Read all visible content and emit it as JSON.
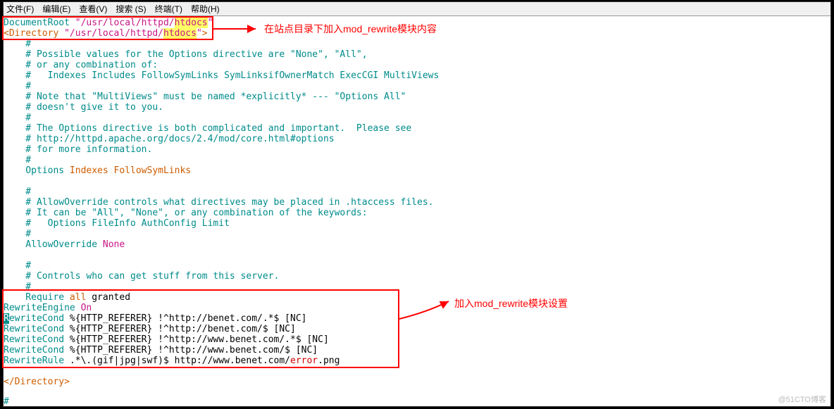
{
  "menu": {
    "file": "文件(F)",
    "edit": "编辑(E)",
    "view": "查看(V)",
    "search": "搜索 (S)",
    "terminal": "终端(T)",
    "help": "帮助(H)"
  },
  "doc": {
    "docroot_key": "DocumentRoot",
    "dir_key": "<Directory",
    "dir_close": ">",
    "path_prefix": " \"/usr/local/httpd/",
    "path_hl": "htdocs",
    "path_suffix": "\"",
    "c_indent": "    # ",
    "c_hashonly": "    #",
    "c_possible": "Possible values for the Options directive are \"None\", \"All\",",
    "c_orany": "or any combination of:",
    "c_indexes": "  Indexes Includes FollowSymLinks SymLinksifOwnerMatch ExecCGI MultiViews",
    "c_note": "Note that \"MultiViews\" must be named *explicitly* --- \"Options All\"",
    "c_doesnt": "doesn't give it to you.",
    "c_optdir": "The Options directive is both complicated and important.  Please see",
    "c_http": "http://httpd.apache.org/docs/2.4/mod/core.html#options",
    "c_formore": "for more information.",
    "options_key": "    Options",
    "options_val": " Indexes FollowSymLinks",
    "c_allowctrl": "AllowOverride controls what directives may be placed in .htaccess files.",
    "c_itcanbe": "It can be \"All\", \"None\", or any combination of the keywords:",
    "c_optfile": "  Options FileInfo AuthConfig Limit",
    "allowover_key": "    AllowOverride",
    "allowover_val": " None",
    "c_controls": "Controls who can get stuff from this server.",
    "require_key": "    Require",
    "require_all": " all",
    "require_granted": " granted",
    "re_engine": "RewriteEngine",
    "re_on": " On",
    "re_cond": "ewriteCond",
    "re_rfirst": "R",
    "re_rnorm": "R",
    "rc1": " %{HTTP_REFERER} !^http://benet.com/.*$ [NC]",
    "rc2": " %{HTTP_REFERER} !^http://benet.com/$ [NC]",
    "rc3": " %{HTTP_REFERER} !^http://www.benet.com/.*$ [NC]",
    "rc4": " %{HTTP_REFERER} !^http://www.benet.com/$ [NC]",
    "re_rule": "RewriteRule",
    "rr_pre": " .*\\.(gif|jpg|swf)$ http://www.benet.com/",
    "rr_err": "error",
    "rr_suf": ".png",
    "end_dir": "</Directory>",
    "last_hash": "#"
  },
  "annot": {
    "top": "在站点目录下加入mod_rewrite模块内容",
    "mid": "加入mod_rewrite模块设置"
  },
  "watermark": "@51CTO博客"
}
